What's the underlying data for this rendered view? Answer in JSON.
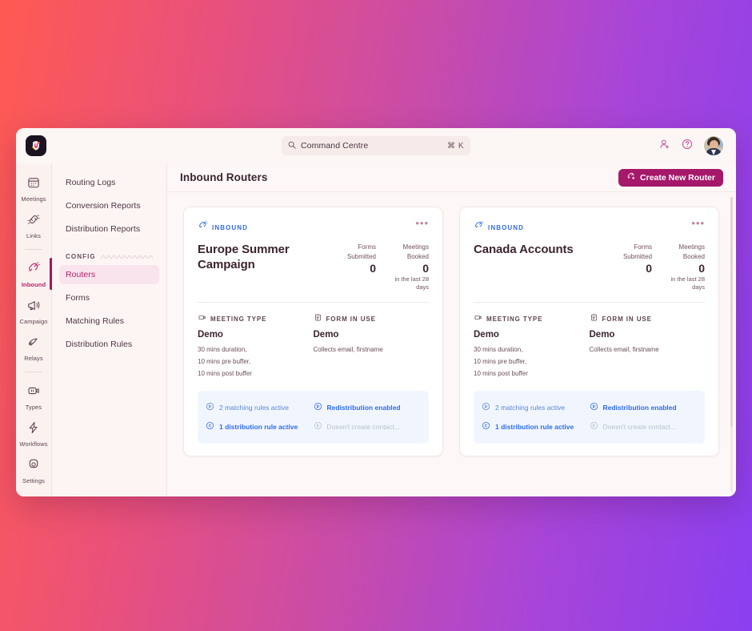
{
  "theme": {
    "bg_gradient_from": "#FF5A52",
    "bg_gradient_to": "#8A3FF0",
    "accent_magenta": "#A5186A",
    "accent_blue": "#2F6BEF",
    "window_bg": "#FDF8F6"
  },
  "topbar": {
    "logo_name": "app-logo",
    "search": {
      "placeholder": "Command Centre",
      "shortcut": "⌘ K",
      "icon": "search-icon"
    },
    "actions": [
      {
        "icon": "add-user-icon",
        "name": "invite-user-button"
      },
      {
        "icon": "help-circle-icon",
        "name": "help-button"
      }
    ],
    "avatar_alt": "user-avatar"
  },
  "rail": {
    "items": [
      {
        "label": "Meetings",
        "icon": "calendar-icon",
        "active": false
      },
      {
        "label": "Links",
        "icon": "link-icon",
        "active": false
      },
      {
        "label": "Inbound",
        "icon": "magnet-icon",
        "active": true
      },
      {
        "label": "Campaign",
        "icon": "megaphone-icon",
        "active": false
      },
      {
        "label": "Relays",
        "icon": "relay-icon",
        "active": false
      },
      {
        "label": "Types",
        "icon": "meeting-type-icon",
        "active": false
      },
      {
        "label": "Workflows",
        "icon": "workflow-bolt-icon",
        "active": false
      }
    ],
    "settings": {
      "label": "Settings",
      "icon": "gear-icon"
    }
  },
  "subnav": {
    "top_items": [
      {
        "label": "Routing Logs",
        "active": false
      },
      {
        "label": "Conversion Reports",
        "active": false
      },
      {
        "label": "Distribution Reports",
        "active": false
      }
    ],
    "group_label": "CONFIG",
    "group_items": [
      {
        "label": "Routers",
        "active": true
      },
      {
        "label": "Forms",
        "active": false
      },
      {
        "label": "Matching Rules",
        "active": false
      },
      {
        "label": "Distribution Rules",
        "active": false
      }
    ]
  },
  "main": {
    "title": "Inbound Routers",
    "create_button": {
      "label": "Create New Router",
      "icon": "magnet-plus-icon"
    }
  },
  "cards": [
    {
      "badge": "INBOUND",
      "badge_icon": "magnet-icon",
      "menu_icon": "more-horizontal-icon",
      "name": "Europe Summer Campaign",
      "stats": [
        {
          "label": "Forms Submitted",
          "value": "0",
          "sub": ""
        },
        {
          "label": "Meetings Booked",
          "value": "0",
          "sub": "in the last 28 days"
        }
      ],
      "columns": [
        {
          "head": "MEETING TYPE",
          "head_icon": "meeting-type-icon",
          "value": "Demo",
          "meta": "30 mins duration,\n10 mins pre buffer,\n10 mins post buffer"
        },
        {
          "head": "FORM IN USE",
          "head_icon": "form-icon",
          "value": "Demo",
          "meta": "Collects email, firstname"
        }
      ],
      "chips": [
        {
          "text": "2 matching rules active",
          "style": "plain",
          "icon": "rule-circle-icon"
        },
        {
          "text": "Redistribution enabled",
          "style": "bold",
          "icon": "redistribute-circle-icon"
        },
        {
          "text": "1 distribution rule active",
          "style": "bold",
          "icon": "distribute-circle-icon"
        },
        {
          "text": "Doesn't create contact...",
          "style": "dim",
          "icon": "contact-circle-icon"
        }
      ]
    },
    {
      "badge": "INBOUND",
      "badge_icon": "magnet-icon",
      "menu_icon": "more-horizontal-icon",
      "name": "Canada Accounts",
      "stats": [
        {
          "label": "Forms Submitted",
          "value": "0",
          "sub": ""
        },
        {
          "label": "Meetings Booked",
          "value": "0",
          "sub": "in the last 28 days"
        }
      ],
      "columns": [
        {
          "head": "MEETING TYPE",
          "head_icon": "meeting-type-icon",
          "value": "Demo",
          "meta": "30 mins duration,\n10 mins pre buffer,\n10 mins post buffer"
        },
        {
          "head": "FORM IN USE",
          "head_icon": "form-icon",
          "value": "Demo",
          "meta": "Collects email, firstname"
        }
      ],
      "chips": [
        {
          "text": "2 matching rules active",
          "style": "plain",
          "icon": "rule-circle-icon"
        },
        {
          "text": "Redistribution enabled",
          "style": "bold",
          "icon": "redistribute-circle-icon"
        },
        {
          "text": "1 distribution rule active",
          "style": "bold",
          "icon": "distribute-circle-icon"
        },
        {
          "text": "Doesn't create contact...",
          "style": "dim",
          "icon": "contact-circle-icon"
        }
      ]
    }
  ]
}
